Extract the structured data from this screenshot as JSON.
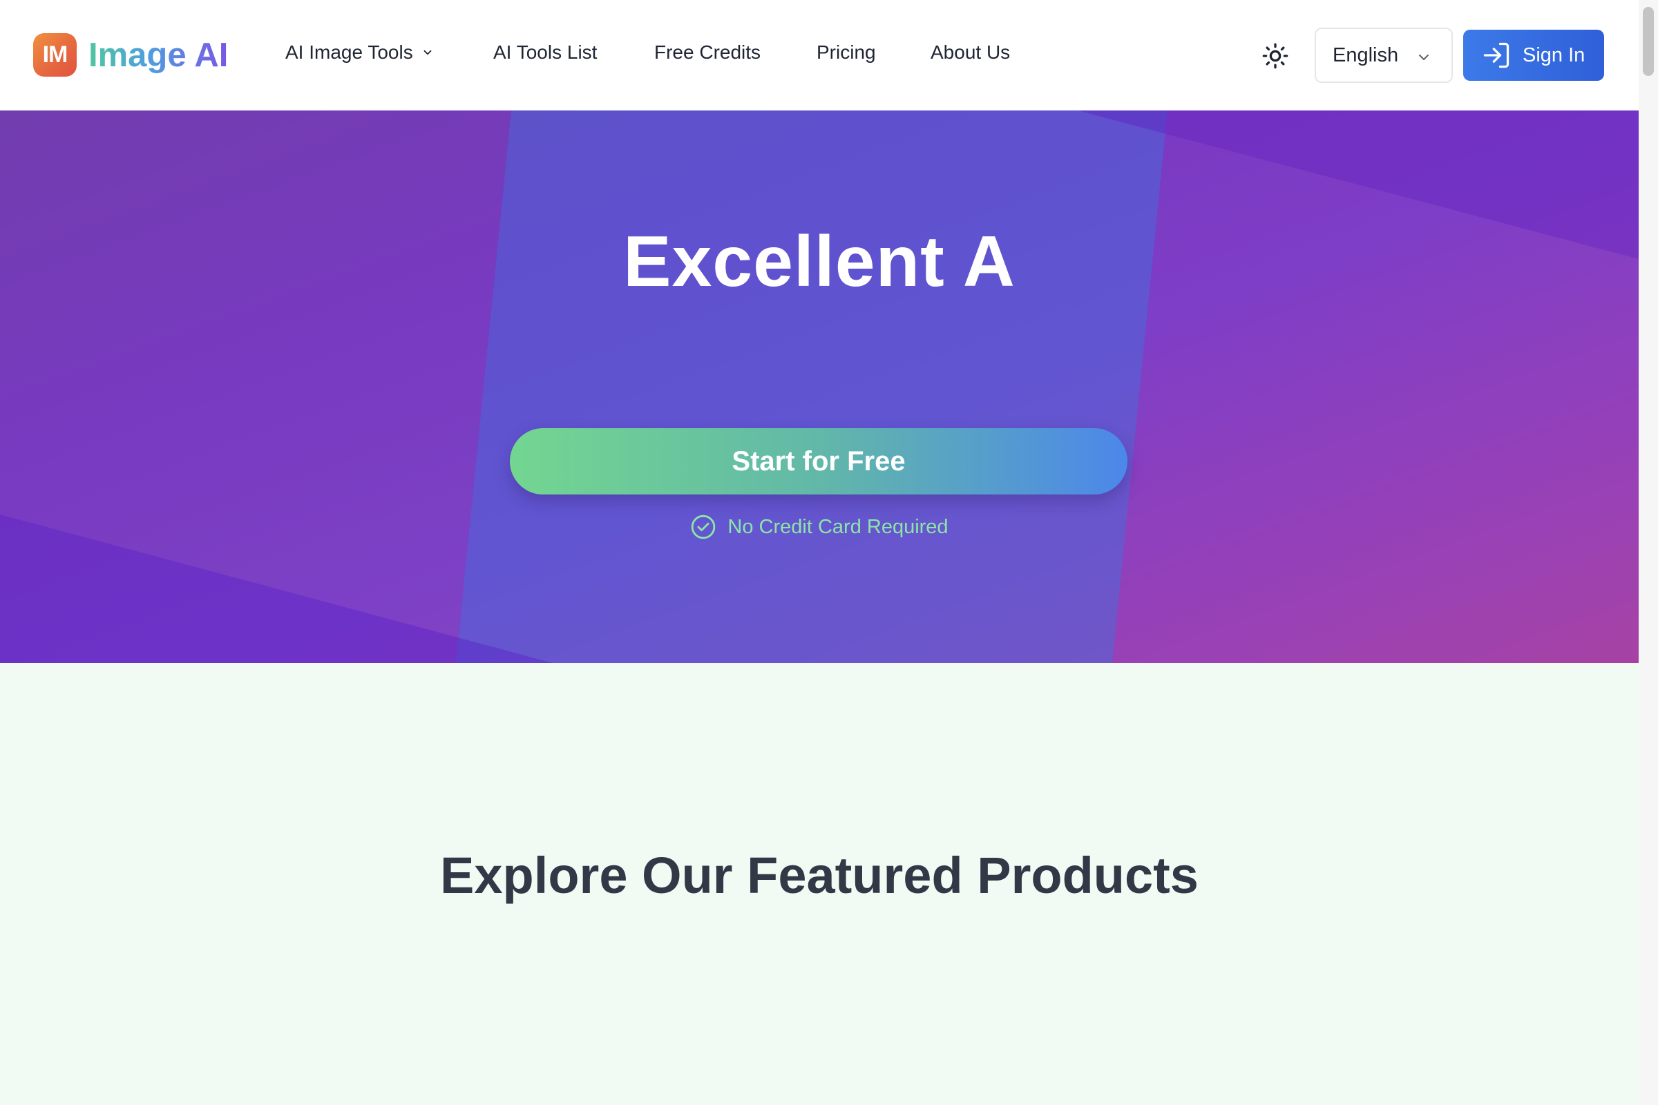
{
  "brand": {
    "badge": "IM",
    "name": "Image AI"
  },
  "nav": {
    "items": [
      {
        "label": "AI Image Tools",
        "has_dropdown": true
      },
      {
        "label": "AI Tools List"
      },
      {
        "label": "Free Credits"
      },
      {
        "label": "Pricing"
      },
      {
        "label": "About Us"
      }
    ]
  },
  "header": {
    "theme_toggle_icon": "sun-icon",
    "language": {
      "selected": "English"
    },
    "sign_in_label": "Sign In"
  },
  "hero": {
    "title": "Excellent A",
    "cta_label": "Start for Free",
    "note": "No Credit Card Required"
  },
  "featured": {
    "title": "Explore Our Featured Products"
  },
  "colors": {
    "accent_blue": "#3d7ae8",
    "hero_purple": "#7436c0",
    "note_green": "#8be6a6",
    "section_bg": "#f1fbf3"
  }
}
